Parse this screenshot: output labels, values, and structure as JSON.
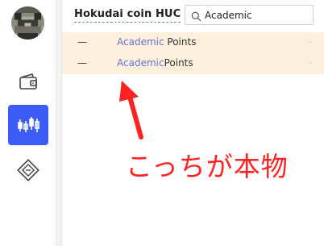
{
  "header": {
    "title": "Hokudai coin HUC"
  },
  "search": {
    "value": "Academic"
  },
  "results": [
    {
      "dash": "—",
      "match": "Academic",
      "rest": " Points",
      "value": "-"
    },
    {
      "dash": "—",
      "match": "Academic",
      "rest": "Points",
      "value": "-"
    }
  ],
  "annotation": {
    "text": "こっちが本物",
    "color": "#ff2222"
  },
  "colors": {
    "accent": "#3b5cf6",
    "highlight": "#6672d8",
    "row_background": "#fcf0dc"
  }
}
